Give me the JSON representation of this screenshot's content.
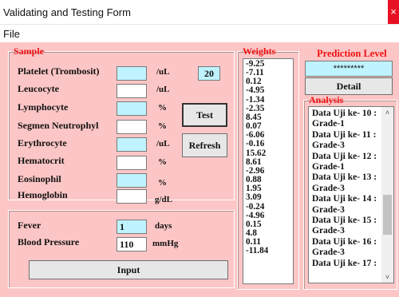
{
  "window": {
    "title": "Validating and Testing Form",
    "close_glyph": "×"
  },
  "menu": {
    "file": "File"
  },
  "sample": {
    "legend": "Sample",
    "fields": [
      {
        "label": "Platelet (Trombosit)",
        "unit": "/uL",
        "value": ""
      },
      {
        "label": "Leucocyte",
        "unit": "/uL",
        "value": ""
      },
      {
        "label": "Lymphocyte",
        "unit": "%",
        "value": ""
      },
      {
        "label": "Segmen Neutrophyl",
        "unit": "%",
        "value": ""
      },
      {
        "label": "Erythrocyte",
        "unit": "/uL",
        "value": ""
      },
      {
        "label": "Hematocrit",
        "unit": "%",
        "value": ""
      },
      {
        "label": "Eosinophil",
        "unit": "%",
        "value": ""
      },
      {
        "label": "Hemoglobin",
        "unit": "g/dL",
        "value": ""
      }
    ],
    "count_value": "20",
    "test_button": "Test",
    "refresh_button": "Refresh"
  },
  "vitals": {
    "fever": {
      "label": "Fever",
      "value": "1",
      "unit": "days"
    },
    "bp": {
      "label": "Blood Pressure",
      "value": "110",
      "unit": "mmHg"
    },
    "input_button": "Input"
  },
  "weights": {
    "legend": "Weights",
    "items": [
      "-9.25",
      "-7.11",
      "0.12",
      "-4.95",
      "-1.34",
      "-2.35",
      "8.45",
      "0.07",
      "-6.06",
      "-0.16",
      "15.62",
      "8.61",
      "-2.96",
      "0.88",
      "1.95",
      "3.09",
      "-0.24",
      "-4.96",
      "0.15",
      "4.8",
      "0.11",
      "-11.84"
    ]
  },
  "prediction": {
    "title": "Prediction Level",
    "value": "*********",
    "detail_button": "Detail"
  },
  "analysis": {
    "legend": "Analysis",
    "items": [
      "Data Uji ke- 10 :",
      "Grade-1",
      "Data Uji ke- 11 :",
      "Grade-3",
      "Data Uji ke- 12 :",
      "Grade-1",
      "Data Uji ke- 13 :",
      "Grade-3",
      "Data Uji ke- 14 :",
      "Grade-3",
      "Data Uji ke- 15 :",
      "Grade-3",
      "Data Uji ke- 16 :",
      "Grade-3",
      "Data Uji ke- 17 :"
    ]
  },
  "colors": {
    "form_bg": "#fdc6c6",
    "legend_red": "#ee1111",
    "input_cyan": "#bff3ff",
    "close_red": "#e81123"
  },
  "icons": {
    "scroll_up": "chevron-up-icon",
    "scroll_down": "chevron-down-icon"
  }
}
